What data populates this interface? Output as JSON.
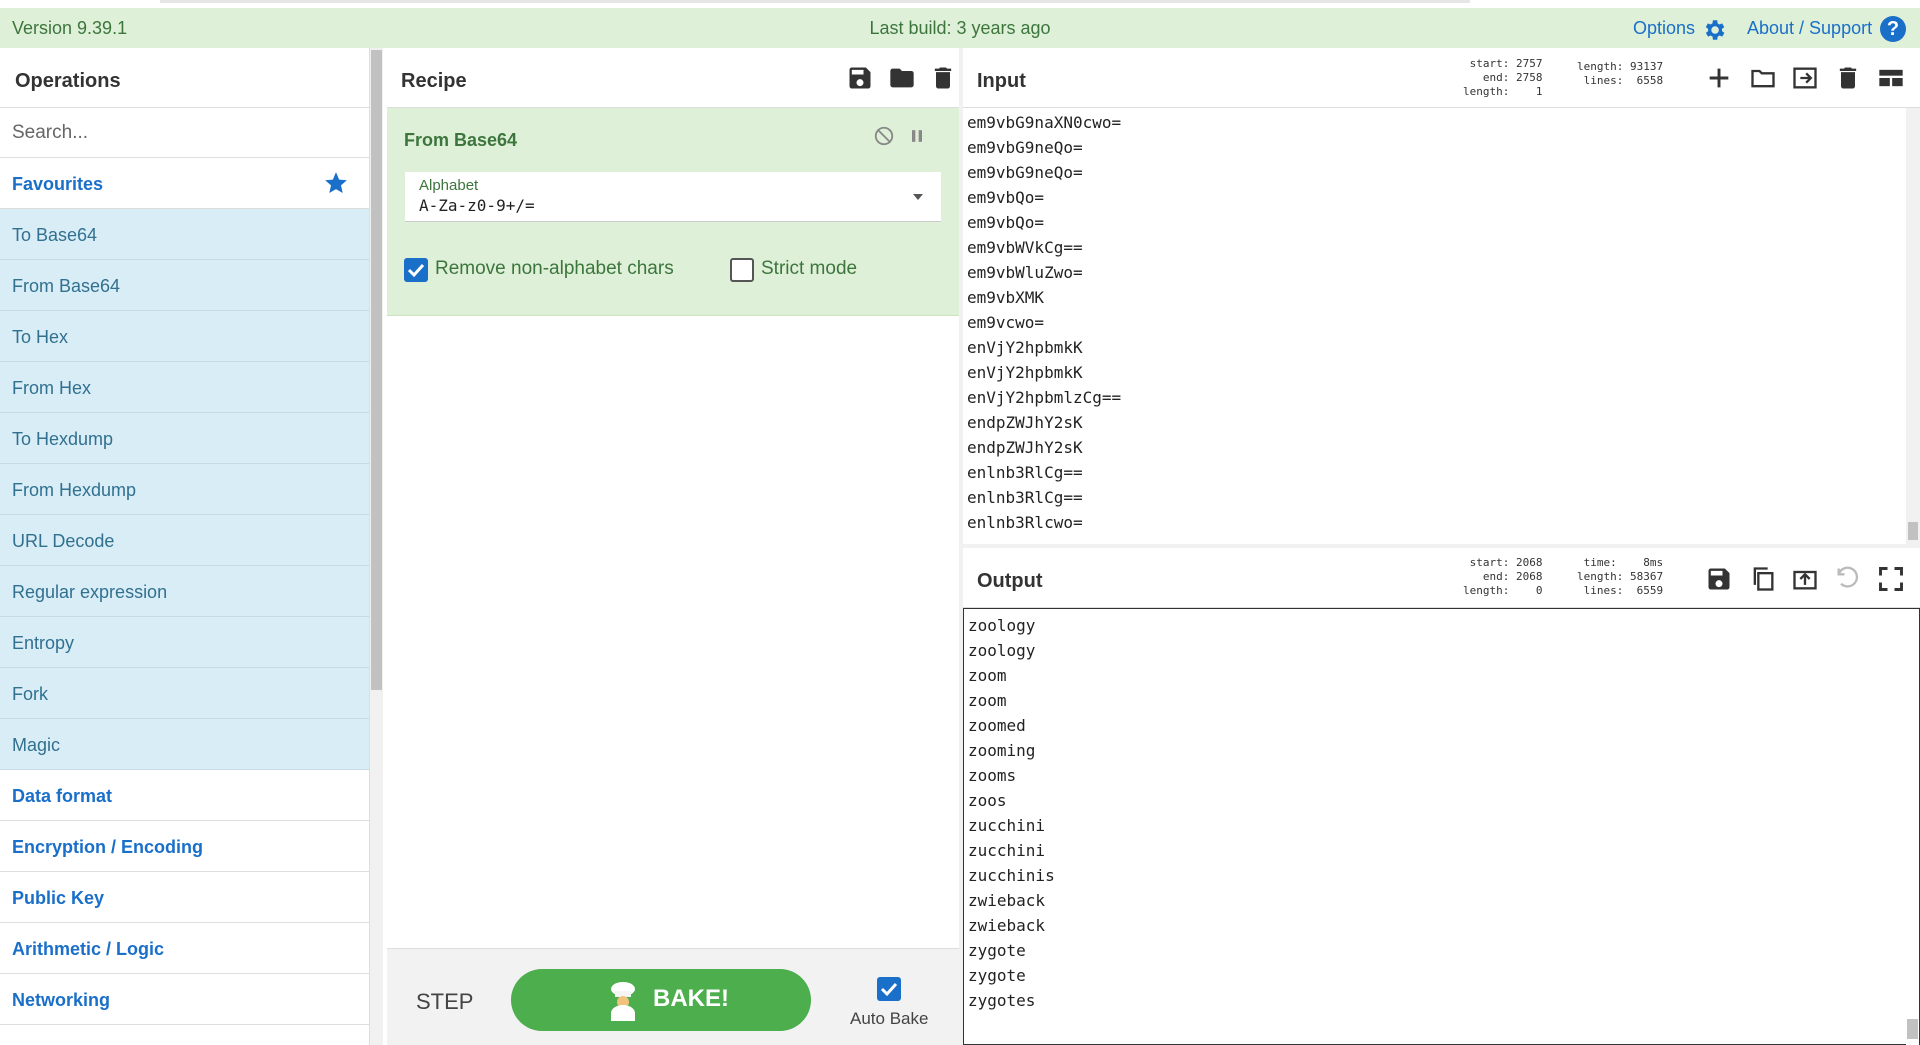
{
  "banner": {
    "version": "Version 9.39.1",
    "last_build": "Last build: 3 years ago",
    "options_label": "Options",
    "about_label": "About / Support",
    "help_glyph": "?"
  },
  "operations": {
    "title": "Operations",
    "search_placeholder": "Search...",
    "favourites_label": "Favourites",
    "favourites": [
      "To Base64",
      "From Base64",
      "To Hex",
      "From Hex",
      "To Hexdump",
      "From Hexdump",
      "URL Decode",
      "Regular expression",
      "Entropy",
      "Fork",
      "Magic"
    ],
    "categories": [
      "Data format",
      "Encryption / Encoding",
      "Public Key",
      "Arithmetic / Logic",
      "Networking"
    ]
  },
  "recipe": {
    "title": "Recipe",
    "operation_name": "From Base64",
    "alphabet_label": "Alphabet",
    "alphabet_value": "A-Za-z0-9+/=",
    "remove_nonalpha_label": "Remove non-alphabet chars",
    "remove_nonalpha_checked": true,
    "strict_mode_label": "Strict mode",
    "strict_mode_checked": false,
    "step_label": "STEP",
    "bake_label": "BAKE!",
    "auto_bake_label": "Auto Bake",
    "auto_bake_checked": true
  },
  "input": {
    "title": "Input",
    "stats_left": "start: 2757\n  end: 2758\nlength:    1",
    "stats_right": "length: 93137\n lines:  6558",
    "lines": [
      "em9vbG9naXN0cwo=",
      "em9vbG9neQo=",
      "em9vbG9neQo=",
      "em9vbQo=",
      "em9vbQo=",
      "em9vbWVkCg==",
      "em9vbWluZwo=",
      "em9vbXMK",
      "em9vcwo=",
      "enVjY2hpbmkK",
      "enVjY2hpbmkK",
      "enVjY2hpbmlzCg==",
      "endpZWJhY2sK",
      "endpZWJhY2sK",
      "enlnb3RlCg==",
      "enlnb3RlCg==",
      "enlnb3Rlcwo="
    ]
  },
  "output": {
    "title": "Output",
    "stats_left": "start: 2068\n  end: 2068\nlength:    0",
    "stats_right": "time:    8ms\nlength: 58367\n lines:  6559",
    "lines": [
      "zoology",
      "zoology",
      "zoom",
      "zoom",
      "zoomed",
      "zooming",
      "zooms",
      "zoos",
      "zucchini",
      "zucchini",
      "zucchinis",
      "zwieback",
      "zwieback",
      "zygote",
      "zygote",
      "zygotes"
    ]
  },
  "colors": {
    "banner_bg": "#dff0d8",
    "accent": "#1a6fc9",
    "favourite_bg": "#d9edf7",
    "bake_green": "#4cae4c"
  }
}
